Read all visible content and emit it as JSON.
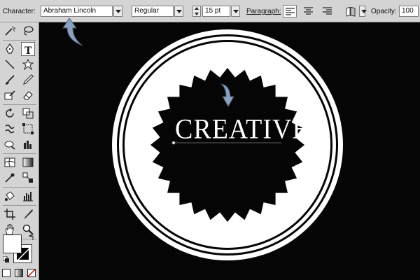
{
  "options_bar": {
    "character_label": "Character:",
    "font_family": "Abraham Lincoln",
    "font_style": "Regular",
    "font_size": "15 pt",
    "paragraph_label": "Paragraph:",
    "opacity_label": "Opacity:",
    "opacity_value": "100"
  },
  "canvas": {
    "headline": "CREATIVE"
  },
  "colors": {
    "canvas_bg": "#050505",
    "panel_bg": "#d4d4d4",
    "arrow_blue": "#8aa2bf"
  },
  "tools": [
    "magic-wand",
    "lasso",
    "pen",
    "type",
    "line",
    "star",
    "paintbrush",
    "pencil",
    "eraser",
    "bucket",
    "rotate",
    "scale",
    "warp",
    "free-transform",
    "symbol-sprayer",
    "graph",
    "mesh",
    "gradient",
    "eyedropper",
    "blend",
    "live-paint",
    "column-graph",
    "artboard",
    "slice",
    "hand",
    "zoom",
    "fill",
    "stroke",
    "swap-colors",
    "default-colors",
    "color-mode",
    "gradient-mode",
    "none-mode"
  ]
}
